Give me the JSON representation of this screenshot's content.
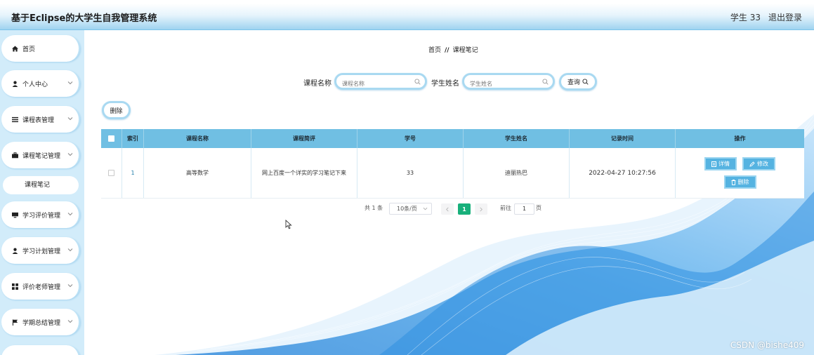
{
  "header": {
    "title": "基于Eclipse的大学生自我管理系统",
    "user": "学生 33",
    "logout": "退出登录"
  },
  "sidebar": {
    "items": [
      {
        "label": "首页",
        "icon": "home-icon"
      },
      {
        "label": "个人中心",
        "icon": "user-icon"
      },
      {
        "label": "课程表管理",
        "icon": "list-icon"
      },
      {
        "label": "课程笔记管理",
        "icon": "briefcase-icon"
      },
      {
        "label": "学习评价管理",
        "icon": "monitor-icon"
      },
      {
        "label": "学习计划管理",
        "icon": "user-icon"
      },
      {
        "label": "评价老师管理",
        "icon": "grid-icon"
      },
      {
        "label": "学期总结管理",
        "icon": "flag-icon"
      }
    ],
    "subitem": "课程笔记"
  },
  "breadcrumb": {
    "home": "首页",
    "separator": "//",
    "current": "课程笔记"
  },
  "search": {
    "course_label": "课程名称",
    "course_placeholder": "课程名称",
    "student_label": "学生姓名",
    "student_placeholder": "学生姓名",
    "query_label": "查询"
  },
  "toolbar": {
    "delete_label": "删除"
  },
  "table": {
    "columns": [
      "索引",
      "课程名称",
      "课程简评",
      "学号",
      "学生姓名",
      "记录时间",
      "操作"
    ],
    "rows": [
      {
        "index": "1",
        "course": "高等数学",
        "comment": "网上百度一个详实的学习笔记下来",
        "student_no": "33",
        "student_name": "迪丽热巴",
        "time": "2022-04-27 10:27:56",
        "actions": {
          "detail": "详情",
          "edit": "修改",
          "delete": "删除"
        }
      }
    ]
  },
  "pagination": {
    "total": "共 1 条",
    "page_size": "10条/页",
    "current_page": "1",
    "goto_label": "前往",
    "goto_value": "1",
    "page_unit": "页"
  },
  "watermark": "CSDN @bishe409",
  "colors": {
    "accent": "#70bfe3",
    "button": "#55b3e1",
    "active_page": "#18b07b",
    "sidebar_bg": "#d2ecfa"
  }
}
